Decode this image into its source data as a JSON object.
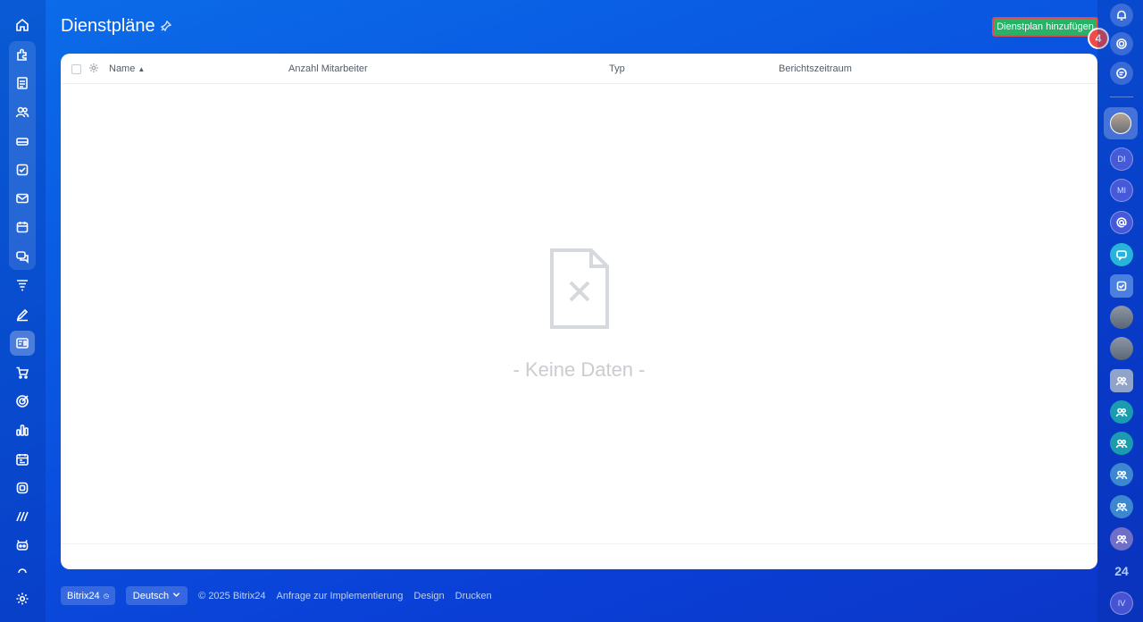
{
  "header": {
    "title": "Dienstpläne",
    "add_button_label": "Dienstplan hinzufügen",
    "step_badge": "4"
  },
  "table": {
    "columns": [
      "Name",
      "Anzahl Mitarbeiter",
      "Typ",
      "Berichtszeitraum"
    ],
    "sort_indicator": "^",
    "empty_text": "- Keine Daten -"
  },
  "footer": {
    "brand": "Bitrix24",
    "language": "Deutsch",
    "copyright": "© 2025 Bitrix24",
    "links": [
      "Anfrage zur Implementierung",
      "Design",
      "Drucken"
    ]
  },
  "right_bar": {
    "avatars": [
      "DI",
      "MI",
      "IV"
    ],
    "counter_label": "24"
  },
  "left_bar": {
    "icons": [
      "home-icon",
      "puzzle-icon",
      "document-icon",
      "users-icon",
      "inbox-icon",
      "task-icon",
      "mail-icon",
      "calendar-icon",
      "chat-icon",
      "filter-icon",
      "sign-icon",
      "shifts-icon",
      "cart-icon",
      "target-icon",
      "chart-icon",
      "planner-icon",
      "widget-icon",
      "brand-icon",
      "robot-icon",
      "settings-icon"
    ]
  },
  "colors": {
    "accent_green": "#28b267",
    "badge_red": "#ef4b4b",
    "background_blue": "#0a55e0"
  }
}
